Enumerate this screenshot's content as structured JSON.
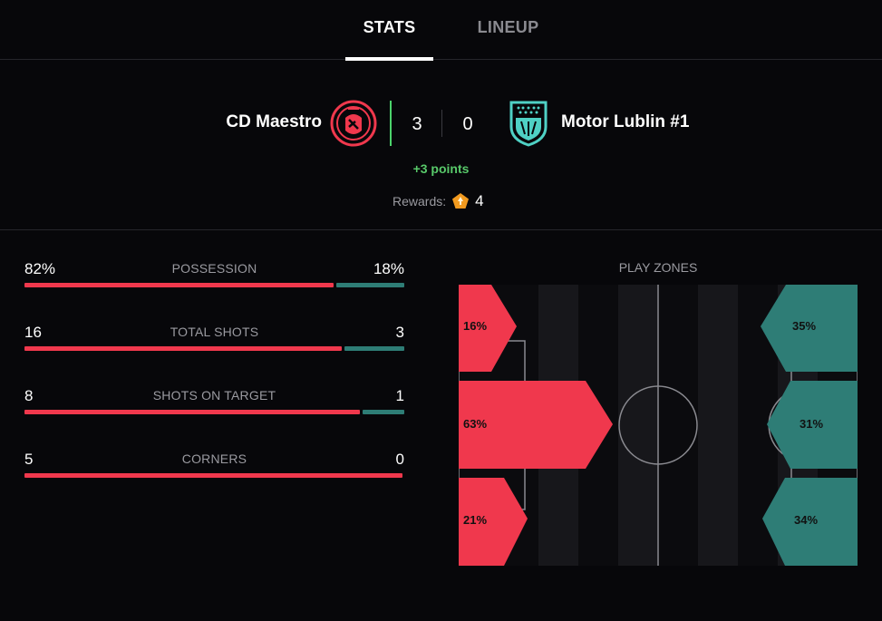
{
  "tabs": [
    {
      "label": "STATS",
      "active": true
    },
    {
      "label": "LINEUP",
      "active": false
    }
  ],
  "match": {
    "home": {
      "name": "CD Maestro",
      "score": "3",
      "crest_icon": "maestro-crest-icon",
      "color": "#f0384d"
    },
    "away": {
      "name": "Motor Lublin #1",
      "score": "0",
      "crest_icon": "shield-crest-icon",
      "color": "#2e7d76"
    },
    "points_text": "+3 points",
    "rewards_label": "Rewards:",
    "rewards_icon": "pentagon-badge-icon",
    "rewards_count": "4"
  },
  "stats": [
    {
      "label": "POSSESSION",
      "home": "82%",
      "away": "18%",
      "home_value": 82,
      "away_value": 18
    },
    {
      "label": "TOTAL SHOTS",
      "home": "16",
      "away": "3",
      "home_value": 16,
      "away_value": 3
    },
    {
      "label": "SHOTS ON TARGET",
      "home": "8",
      "away": "1",
      "home_value": 8,
      "away_value": 1
    },
    {
      "label": "CORNERS",
      "home": "5",
      "away": "0",
      "home_value": 5,
      "away_value": 0
    }
  ],
  "play_zones": {
    "title": "PLAY ZONES",
    "home": {
      "top": "16%",
      "middle": "63%",
      "bottom": "21%"
    },
    "away": {
      "top": "35%",
      "middle": "31%",
      "bottom": "34%"
    }
  },
  "colors": {
    "home_accent": "#f0384d",
    "away_accent": "#2e7d76",
    "points_green": "#58c96a",
    "background": "#07070a"
  }
}
